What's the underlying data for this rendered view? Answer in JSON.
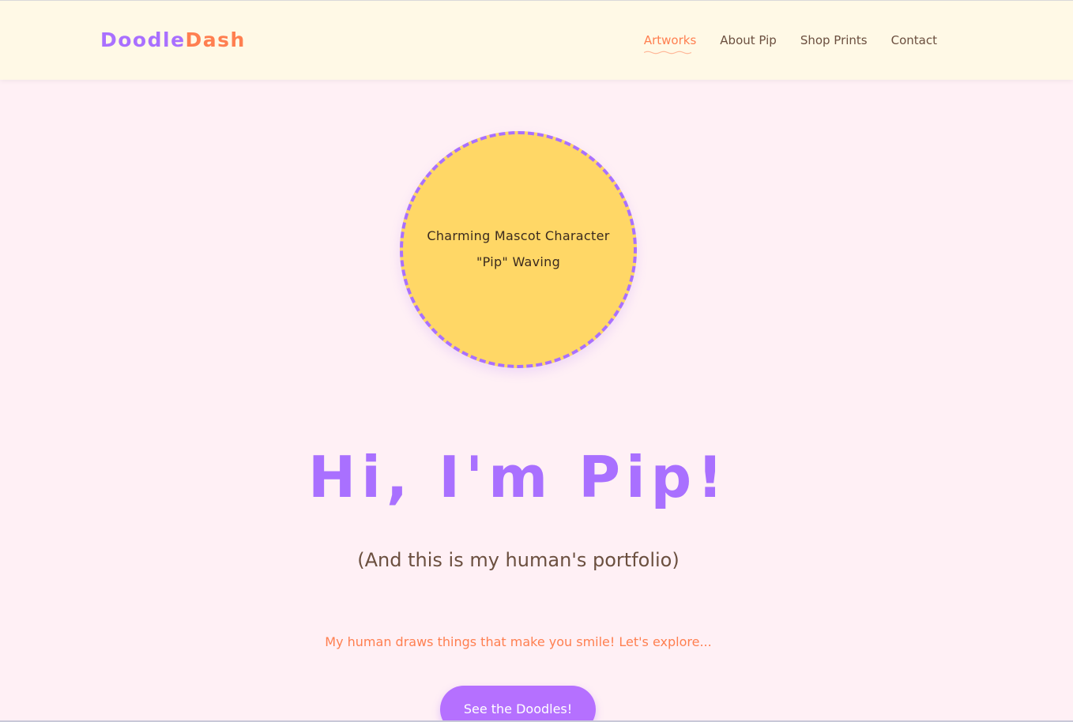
{
  "brand": {
    "logo_part1": "Doodle",
    "logo_part2": "Dash",
    "colors": {
      "purple": "#a970ff",
      "orange": "#ff7f50",
      "header_bg": "#fff9e6",
      "page_bg": "#fff0f5",
      "mascot_fill": "#ffd766",
      "text_brown": "#6b4f3f"
    }
  },
  "nav": {
    "items": [
      {
        "label": "Artworks",
        "active": true
      },
      {
        "label": "About Pip",
        "active": false
      },
      {
        "label": "Shop Prints",
        "active": false
      },
      {
        "label": "Contact",
        "active": false
      }
    ]
  },
  "mascot": {
    "line1": "Charming Mascot Character",
    "line2": "\"Pip\" Waving"
  },
  "hero": {
    "title": "Hi, I'm Pip!",
    "subtitle": "(And this is my human's portfolio)",
    "tagline": "My human draws things that make you smile! Let's explore...",
    "cta_label": "See the Doodles!"
  }
}
